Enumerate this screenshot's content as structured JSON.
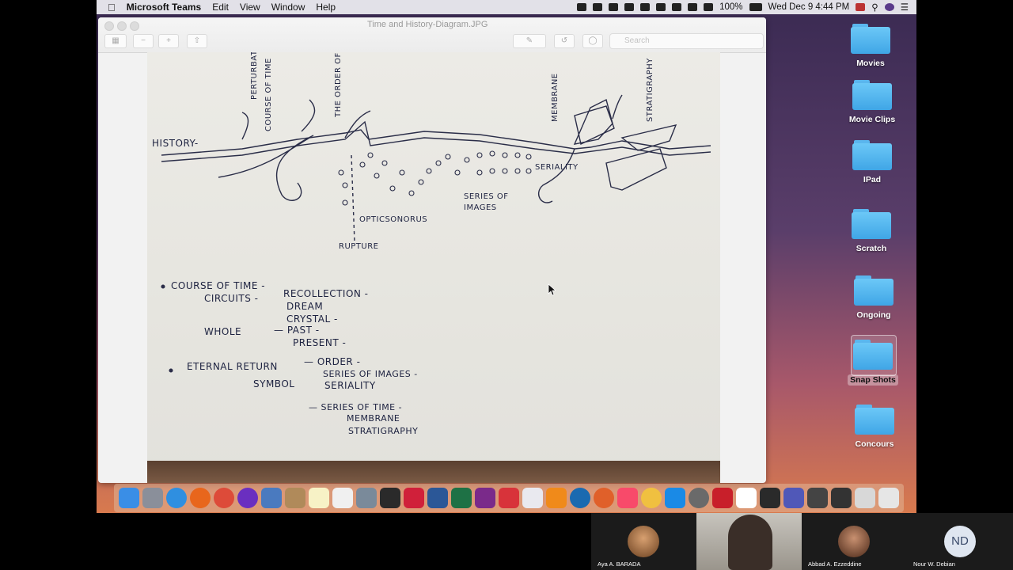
{
  "menubar": {
    "app": "Microsoft Teams",
    "items": [
      "Edit",
      "View",
      "Window",
      "Help"
    ],
    "battery": "100%",
    "clock": "Wed Dec 9  4:44 PM"
  },
  "window": {
    "title": "Time and History-Diagram.JPG",
    "search_placeholder": "Search"
  },
  "sketch": {
    "labels": {
      "perturbation": "PERTURBATION",
      "course_of_time_top": "COURSE OF TIME",
      "order_of_time": "THE ORDER OF TIME",
      "membrane": "MEMBRANE",
      "stratigraphy": "STRATIGRAPHY",
      "history": "HISTORY-",
      "seriality": "SERIALITY",
      "series_of_images": "SERIES OF IMAGES",
      "opticsonorus": "OPTICSONORUS",
      "rupture": "RUPTURE"
    },
    "notes": {
      "course_of_time": "COURSE OF TIME -",
      "circuits": "CIRCUITS -",
      "recollection": "RECOLLECTION -",
      "dream": "DREAM",
      "crystal": "CRYSTAL -",
      "whole": "WHOLE",
      "past": "— PAST -",
      "present": "PRESENT -",
      "eternal_return": "ETERNAL RETURN",
      "order": "— ORDER -",
      "symbol": "SYMBOL",
      "series_images": "SERIES OF IMAGES -",
      "seriality": "SERIALITY",
      "series_time": "— SERIES OF TIME -",
      "membrane": "MEMBRANE",
      "stratigraphy": "STRATIGRAPHY"
    }
  },
  "desktop": [
    {
      "label": "Movies"
    },
    {
      "label": "Movie Clips"
    },
    {
      "label": "IPad"
    },
    {
      "label": "Scratch"
    },
    {
      "label": "Ongoing"
    },
    {
      "label": "Snap Shots"
    },
    {
      "label": "Concours"
    }
  ],
  "participants": [
    {
      "name": "Aya A. BARADA"
    },
    {
      "name": "Abbad A. Ezzeddine"
    },
    {
      "name": "Nour W. Debian",
      "initials": "ND"
    }
  ]
}
